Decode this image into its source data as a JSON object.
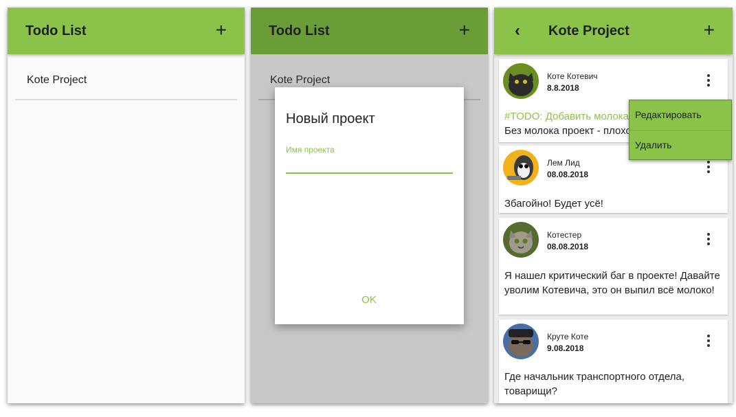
{
  "screen1": {
    "title": "Todo List",
    "add_icon": "plus-icon",
    "projects": [
      {
        "label": "Kote Project"
      }
    ]
  },
  "screen2": {
    "title": "Todo List",
    "projects": [
      {
        "label": "Kote Project"
      }
    ],
    "dialog": {
      "title": "Новый проект",
      "field_label": "Имя проекта",
      "field_value": "",
      "ok_label": "OK"
    }
  },
  "screen3": {
    "title": "Kote Project",
    "back_icon": "chevron-left-icon",
    "cards": [
      {
        "author": "Коте Котевич",
        "date": "8.8.2018",
        "todo": "#TODO: Добавить молока",
        "text": "Без молока проект - плохой"
      },
      {
        "author": "Лем Лид",
        "date": "08.08.2018",
        "text": "Збагойно! Будет усё!"
      },
      {
        "author": "Котестер",
        "date": "08.08.2018",
        "text": "Я нашел критический баг в проекте! Давайте уволим Котевича, это он выпил всё молоко!"
      },
      {
        "author": "Круте Коте",
        "date": "9.08.2018",
        "text": "Где начальник транспортного отдела, товарищи?"
      }
    ],
    "context_menu": {
      "edit": "Редактировать",
      "delete": "Удалить"
    }
  },
  "colors": {
    "accent": "#8bc34a",
    "accent_dim": "#6a9d38"
  }
}
